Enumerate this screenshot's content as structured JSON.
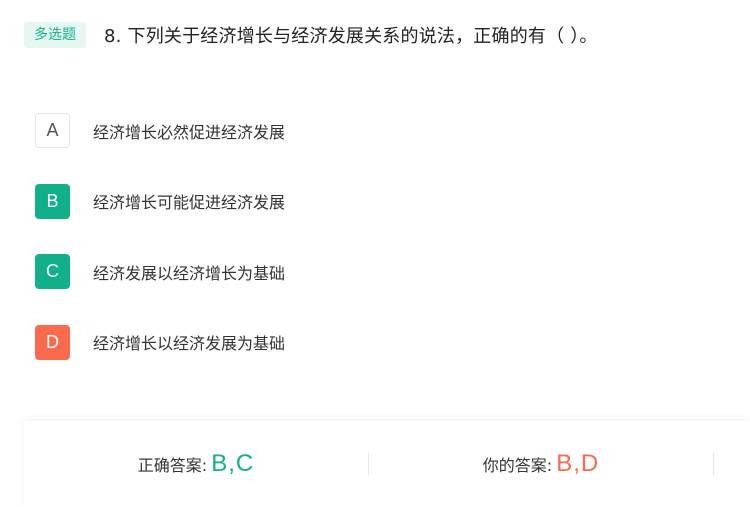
{
  "question": {
    "type_badge": "多选题",
    "text": "8. 下列关于经济增长与经济发展关系的说法，正确的有（ ）。"
  },
  "options": [
    {
      "letter": "A",
      "text": "经济增长必然促进经济发展",
      "state": "neutral"
    },
    {
      "letter": "B",
      "text": "经济增长可能促进经济发展",
      "state": "correct"
    },
    {
      "letter": "C",
      "text": "经济发展以经济增长为基础",
      "state": "correct"
    },
    {
      "letter": "D",
      "text": "经济增长以经济发展为基础",
      "state": "wrong"
    }
  ],
  "answers": {
    "correct_label": "正确答案:",
    "correct_value": "B,C",
    "mine_label": "你的答案:",
    "mine_value": "B,D"
  },
  "colors": {
    "correct": "#12b08a",
    "wrong": "#fa6a4d",
    "badge_bg": "#e5f7f1"
  }
}
